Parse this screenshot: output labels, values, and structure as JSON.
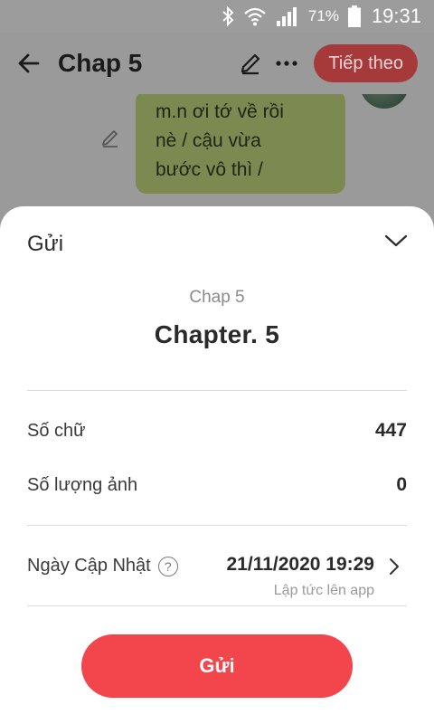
{
  "status_bar": {
    "battery_percent": "71%",
    "time": "19:31",
    "icons": [
      "bluetooth-icon",
      "wifi-icon",
      "signal-icon",
      "battery-icon"
    ]
  },
  "app_bar": {
    "title": "Chap 5",
    "next_label": "Tiếp theo"
  },
  "chat": {
    "bubble_lines": [
      "m.n ơi tớ về rồi",
      "nè / cậu vừa",
      "bước vô thì /"
    ]
  },
  "sheet": {
    "title": "Gửi",
    "chapter_subtitle": "Chap 5",
    "chapter_title": "Chapter. 5",
    "word_count_label": "Số chữ",
    "word_count_value": "447",
    "image_count_label": "Số lượng ảnh",
    "image_count_value": "0",
    "update_date_label": "Ngày Cập Nhật",
    "update_date_value": "21/11/2020 19:29",
    "update_hint": "Lập tức lên app",
    "send_label": "Gửi"
  },
  "colors": {
    "accent": "#f2464c",
    "bubble": "#7c8950",
    "overlay": "#9a9a9a"
  }
}
